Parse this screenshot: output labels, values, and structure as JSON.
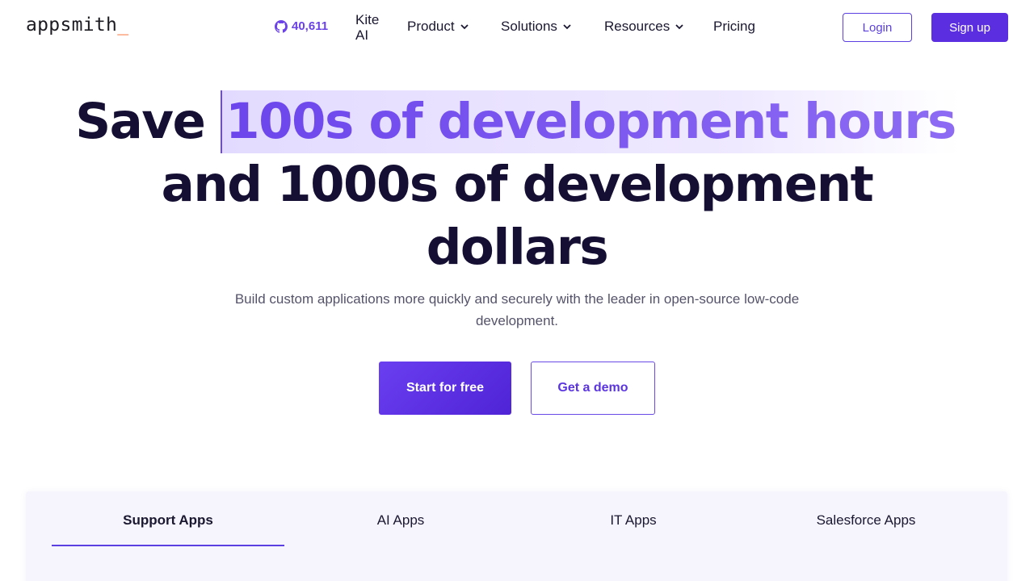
{
  "nav": {
    "logo_text": "appsmith",
    "logo_cursor": "_",
    "github_icon": "github-icon",
    "github_stars": "40,611",
    "kite_line1": "Kite",
    "kite_line2": "AI",
    "product": "Product",
    "solutions": "Solutions",
    "resources": "Resources",
    "pricing": "Pricing",
    "login": "Login",
    "signup": "Sign up"
  },
  "hero": {
    "title_prefix": "Save",
    "title_highlight": "100s of development hours",
    "title_line2": "and 1000s of development",
    "title_line3": "dollars",
    "subtitle": "Build custom applications more quickly and securely with the leader in open-source low-code development.",
    "cta_primary": "Start for free",
    "cta_secondary": "Get a demo"
  },
  "tabs": [
    {
      "label": "Support Apps",
      "active": true
    },
    {
      "label": "AI Apps",
      "active": false
    },
    {
      "label": "IT Apps",
      "active": false
    },
    {
      "label": "Salesforce Apps",
      "active": false
    }
  ],
  "colors": {
    "brand": "#5b2fe0",
    "logo_cursor": "#f86a2b",
    "heading": "#150f33"
  }
}
